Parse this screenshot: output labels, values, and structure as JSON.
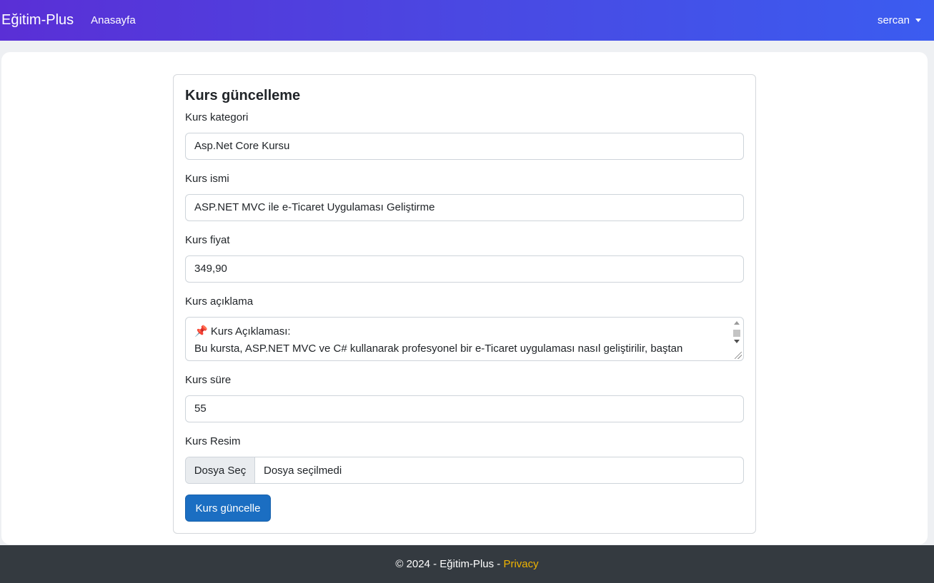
{
  "navbar": {
    "brand": "Eğitim-Plus",
    "home_link": "Anasayfa",
    "user": "sercan"
  },
  "form": {
    "title": "Kurs güncelleme",
    "category": {
      "label": "Kurs kategori",
      "value": "Asp.Net Core Kursu"
    },
    "name": {
      "label": "Kurs ismi",
      "value": "ASP.NET MVC ile e-Ticaret Uygulaması Geliştirme"
    },
    "price": {
      "label": "Kurs fiyat",
      "value": "349,90"
    },
    "description": {
      "label": "Kurs açıklama",
      "icon": "📌",
      "line1": "Kurs Açıklaması:",
      "line2": "Bu kursta, ASP.NET MVC ve C# kullanarak profesyonel bir e-Ticaret uygulaması nasıl geliştirilir, baştan"
    },
    "duration": {
      "label": "Kurs süre",
      "value": "55"
    },
    "image": {
      "label": "Kurs Resim",
      "button": "Dosya Seç",
      "status": "Dosya seçilmedi"
    },
    "submit": "Kurs güncelle"
  },
  "footer": {
    "copyright": "© 2024 - Eğitim-Plus -",
    "privacy": "Privacy"
  },
  "colors": {
    "primary_button": "#1b6ec2",
    "footer_bg": "#343a40",
    "privacy_link": "#f0b400",
    "navbar_gradient_start": "#5a2fd6",
    "navbar_gradient_end": "#3b5cf0"
  }
}
